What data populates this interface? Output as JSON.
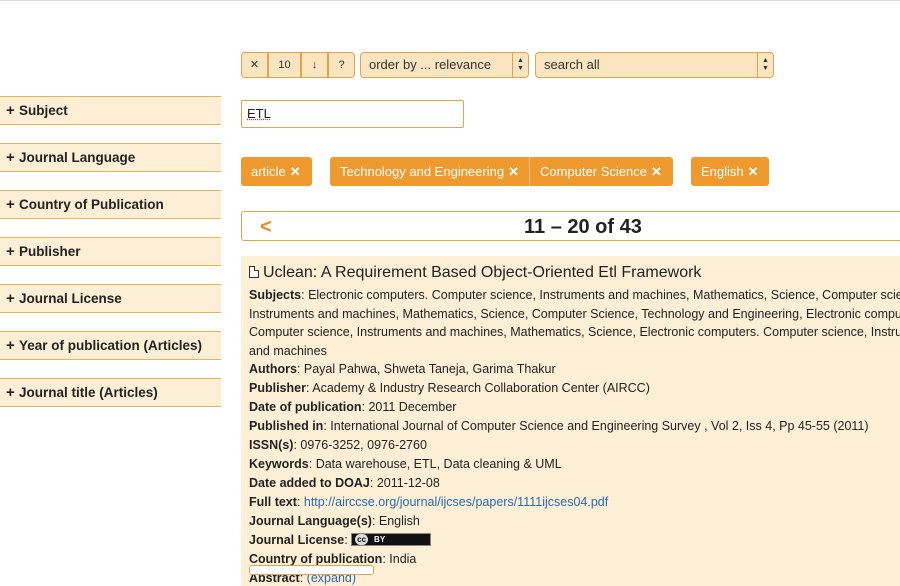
{
  "sidebar": {
    "facets": [
      {
        "label": "Subject"
      },
      {
        "label": "Journal Language"
      },
      {
        "label": "Country of Publication"
      },
      {
        "label": "Publisher"
      },
      {
        "label": "Journal License"
      },
      {
        "label": "Year of publication (Articles)"
      },
      {
        "label": "Journal title (Articles)"
      }
    ],
    "plus": "+"
  },
  "toolbar": {
    "clear": "✕",
    "page_size": "10",
    "sort_dir": "↓",
    "help": "?",
    "order_by": "order by ... relevance",
    "search_scope": "search all"
  },
  "search": {
    "value": "ETL"
  },
  "filters": [
    {
      "label": "article",
      "remove": "✕"
    },
    {
      "label": "Technology and Engineering",
      "remove": "✕"
    },
    {
      "label": "Computer Science",
      "remove": "✕"
    },
    {
      "label": "English",
      "remove": "✕"
    }
  ],
  "pager": {
    "prev": "<",
    "range": "11 – 20 of 43"
  },
  "result": {
    "title": "Uclean: A Requirement Based Object-Oriented Etl Framework",
    "subjects_label": "Subjects",
    "subjects_value": "Electronic computers. Computer science, Instruments and machines, Mathematics, Science, Computer science, Instruments and machines, Mathematics, Science, Computer Science, Technology and Engineering, Electronic computers. Computer science, Instruments and machines, Mathematics, Science, Electronic computers. Computer science, Instruments and machines",
    "authors_label": "Authors",
    "authors_value": "Payal Pahwa, Shweta Taneja, Garima Thakur",
    "publisher_label": "Publisher",
    "publisher_value": "Academy & Industry Research Collaboration Center (AIRCC)",
    "date_label": "Date of publication",
    "date_value": "2011 December",
    "published_in_label": "Published in",
    "published_in_value": "International Journal of Computer Science and Engineering Survey , Vol 2, Iss 4, Pp 45-55 (2011)",
    "issn_label": "ISSN(s)",
    "issn_value": "0976-3252, 0976-2760",
    "keywords_label": "Keywords",
    "keywords_value": "Data warehouse, ETL, Data cleaning & UML",
    "added_label": "Date added to DOAJ",
    "added_value": "2011-12-08",
    "fulltext_label": "Full text",
    "fulltext_value": "http://airccse.org/journal/ijcses/papers/1111ijcses04.pdf",
    "language_label": "Journal Language(s)",
    "language_value": "English",
    "license_label": "Journal License",
    "license_badge_cc": "cc",
    "license_badge_by": "BY",
    "country_label": "Country of publication",
    "country_value": "India",
    "abstract_label": "Abstract",
    "abstract_value": "(expand)"
  }
}
